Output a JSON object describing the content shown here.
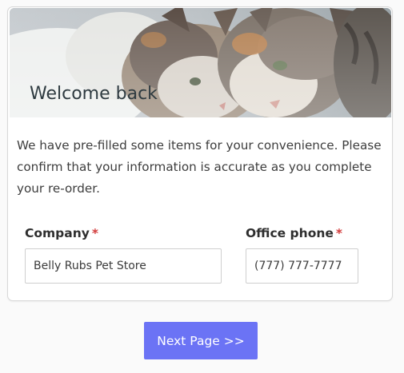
{
  "header": {
    "title": "Welcome back"
  },
  "intro": {
    "text": "We have pre-filled some items for your convenience. Please confirm that your information is accurate as you complete your re-order."
  },
  "fields": {
    "company": {
      "label": "Company",
      "required_mark": "*",
      "value": "Belly Rubs Pet Store"
    },
    "office_phone": {
      "label": "Office phone",
      "required_mark": "*",
      "value": "(777) 777-7777"
    }
  },
  "actions": {
    "next_label": "Next Page >>"
  },
  "colors": {
    "primary_button": "#6b73f5",
    "required_mark": "#d23a3a"
  },
  "images": {
    "hero": "two-cats-photo"
  }
}
